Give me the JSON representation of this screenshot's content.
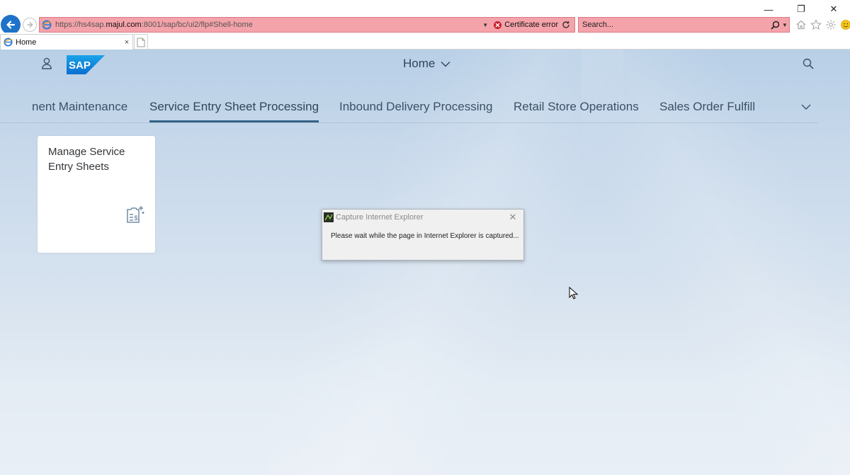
{
  "browser": {
    "url_prefix": "https://hs4sap.",
    "url_domain": "majul.com",
    "url_suffix": ":8001/sap/bc/ui2/flp#Shell-home",
    "certificate_label": "Certificate error",
    "search_placeholder": "Search...",
    "tab_label": "Home",
    "tab_close": "×",
    "window_controls": {
      "minimize": "—",
      "restore": "❐",
      "close": "✕"
    },
    "icons": [
      "back-arrow-icon",
      "forward-arrow-icon",
      "ie-favicon",
      "certificate-error-icon",
      "refresh-icon",
      "search-icon",
      "home-icon",
      "favorites-star-icon",
      "settings-gear-icon",
      "smiley-feedback-icon",
      "new-tab-icon"
    ]
  },
  "shell": {
    "title": "Home",
    "tabs": [
      {
        "label": "nent Maintenance"
      },
      {
        "label": "Service Entry Sheet Processing",
        "active": true
      },
      {
        "label": "Inbound Delivery Processing"
      },
      {
        "label": "Retail Store Operations"
      },
      {
        "label": "Sales Order Fulfill"
      }
    ],
    "tile": {
      "title": "Manage Service Entry Sheets",
      "icon": "document-money-icon"
    },
    "colors": {
      "brand": "#0a6ed1",
      "active_tab_underline": "#346187",
      "text": "#32465a"
    }
  },
  "dialog": {
    "title": "Capture Internet Explorer",
    "message": "Please wait while the page in Internet Explorer is captured..."
  }
}
